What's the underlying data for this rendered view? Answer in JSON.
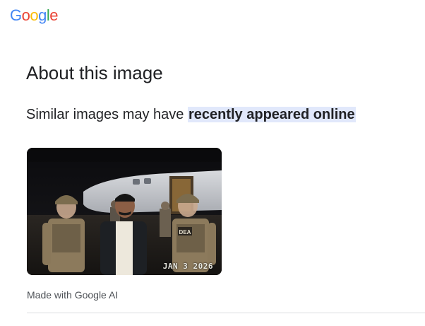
{
  "header": {
    "logo_letters": [
      {
        "char": "G",
        "color": "#4285F4"
      },
      {
        "char": "o",
        "color": "#EA4335"
      },
      {
        "char": "o",
        "color": "#FBBC05"
      },
      {
        "char": "g",
        "color": "#4285F4"
      },
      {
        "char": "l",
        "color": "#34A853"
      },
      {
        "char": "e",
        "color": "#EA4335"
      }
    ]
  },
  "main": {
    "title": "About this image",
    "subtitle_prefix": "Similar images may have ",
    "subtitle_highlight": "recently appeared online",
    "image": {
      "stamp": "JAN  3 2026",
      "badge_text": "DEA"
    },
    "caption": "Made with Google AI"
  },
  "colors": {
    "highlight_bg": "#e1e8fb",
    "caption_text": "#4d5156",
    "divider": "#dadce0"
  }
}
